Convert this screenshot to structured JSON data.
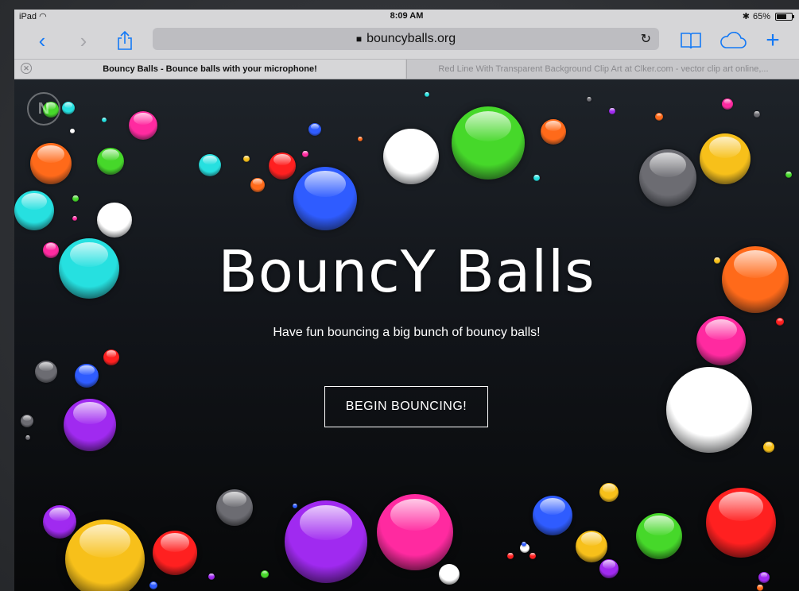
{
  "status_bar": {
    "device": "iPad",
    "time": "8:09 AM",
    "battery": "65%",
    "battery_level": 0.65,
    "icons": [
      "wifi-icon",
      "bluetooth-icon",
      "battery-icon"
    ]
  },
  "toolbar": {
    "back_icon": "chevron-left-icon",
    "forward_icon": "chevron-right-icon",
    "share_icon": "share-icon",
    "address": "bouncyballs.org",
    "reload_icon": "reload-icon",
    "bookmarks_icon": "book-icon",
    "cloud_icon": "cloud-icon",
    "new_tab_icon": "plus-icon",
    "accent_color": "#1479f5"
  },
  "tabs": [
    {
      "title": "Bouncy Balls - Bounce balls with your microphone!",
      "active": true
    },
    {
      "title": "Red Line With Transparent Background Clip Art at Clker.com - vector clip art online,...",
      "active": false
    }
  ],
  "page": {
    "title": "BouncY Balls",
    "subtitle": "Have fun bouncing a big bunch of bouncy balls!",
    "cta": "BEGIN BOUNCING!",
    "logo_icon": "n-logo-icon",
    "ball_colors": [
      "#ff6a1a",
      "#46d82a",
      "#2f5cff",
      "#ff2aa0",
      "#26e0e0",
      "#a02af0",
      "#ff2020",
      "#f7c01a",
      "#ffffff",
      "#6c6c72"
    ]
  }
}
